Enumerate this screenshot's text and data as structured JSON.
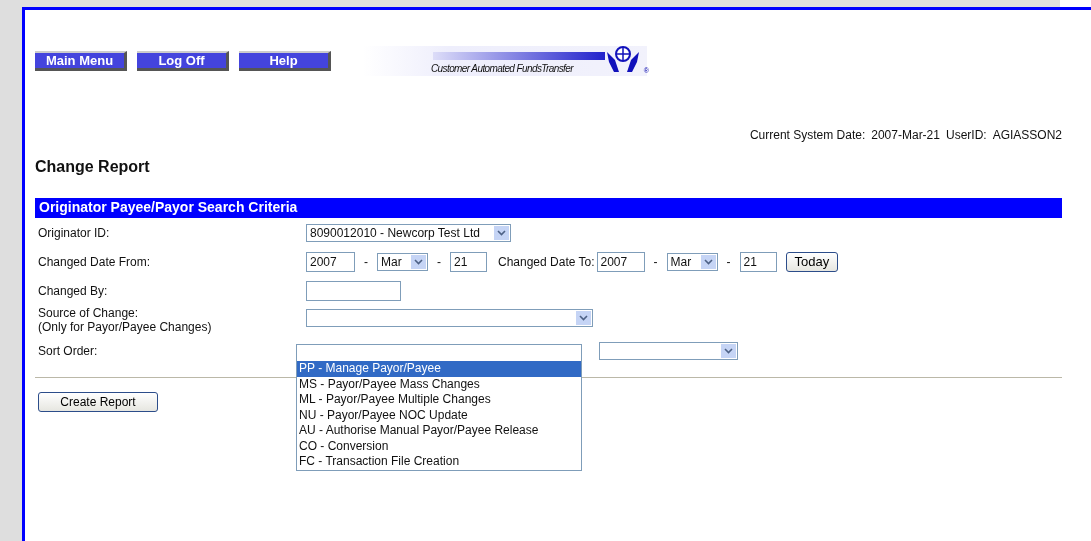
{
  "nav_buttons": [
    "Main Menu",
    "Log Off",
    "Help"
  ],
  "logo": {
    "tagline": "Customer Automated FundsTransfer",
    "mark": "®"
  },
  "system_info": {
    "date_label": "Current System Date:",
    "date": "2007-Mar-21",
    "user_label": "UserID:",
    "user": "AGIASSON2"
  },
  "page_title": "Change Report",
  "section_title": "Originator Payee/Payor Search Criteria",
  "originator": {
    "label": "Originator ID:",
    "value": "8090012010 - Newcorp Test Ltd"
  },
  "date_from": {
    "label": "Changed Date From:",
    "year": "2007",
    "month": "Mar",
    "day": "21"
  },
  "date_to": {
    "label": "Changed Date To:",
    "year": "2007",
    "month": "Mar",
    "day": "21",
    "button": "Today"
  },
  "date_separators": [
    "-",
    "-",
    "-",
    "-"
  ],
  "changed_by": {
    "label": "Changed By:"
  },
  "source_of_change": {
    "label": "Source of Change:",
    "note": "(Only for Payor/Payee Changes)",
    "expanded": true,
    "options": [
      {
        "label": "PP - Manage Payor/Payee",
        "selected": true
      },
      {
        "label": "MS - Payor/Payee Mass Changes",
        "selected": false
      },
      {
        "label": "ML - Payor/Payee Multiple Changes",
        "selected": false
      },
      {
        "label": "NU - Payor/Payee NOC Update",
        "selected": false
      },
      {
        "label": "AU - Authorise Manual Payor/Payee Release",
        "selected": false
      },
      {
        "label": "CO - Conversion",
        "selected": false
      },
      {
        "label": "FC - Transaction File Creation",
        "selected": false
      }
    ]
  },
  "sort_order": {
    "label": "Sort Order:"
  },
  "submit_button": "Create Report"
}
